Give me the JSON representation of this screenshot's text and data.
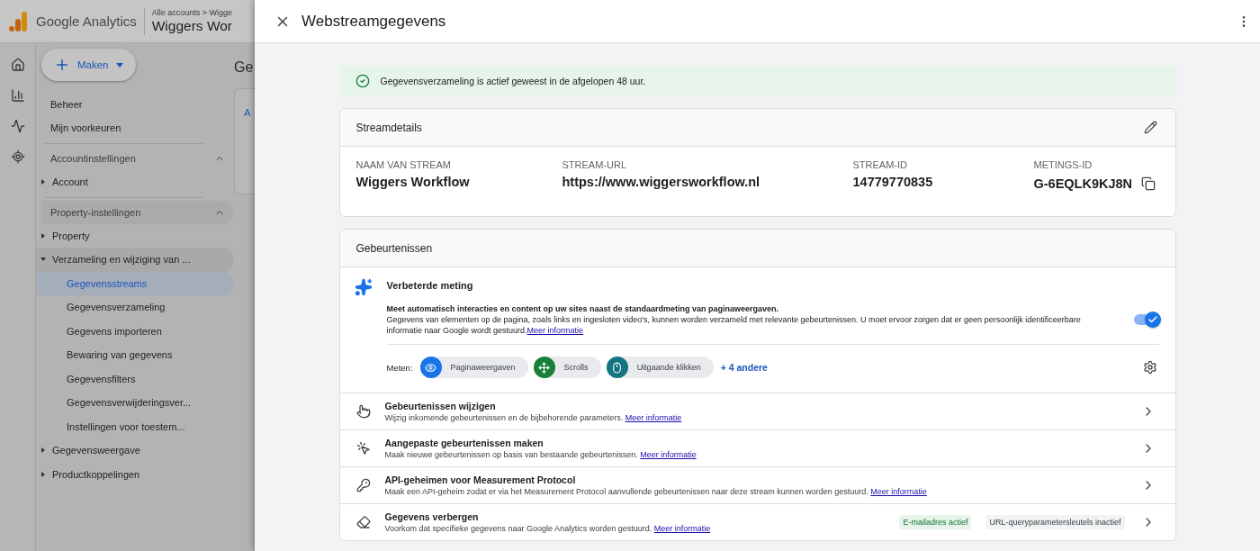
{
  "app": {
    "product": "Google Analytics",
    "breadcrumb": "Alle accounts > Wigge",
    "property": "Wiggers Wor",
    "create_button": "Maken"
  },
  "sidebar": {
    "links": [
      "Beheer",
      "Mijn voorkeuren"
    ],
    "sections": [
      {
        "title": "Accountinstellingen",
        "expanded": true,
        "items": [
          {
            "label": "Account",
            "expanded": false
          }
        ]
      },
      {
        "title": "Property-instellingen",
        "expanded": true,
        "items": [
          {
            "label": "Property",
            "expanded": false
          },
          {
            "label": "Verzameling en wijziging van ...",
            "expanded": true,
            "children": [
              {
                "label": "Gegevensstreams",
                "selected": true
              },
              {
                "label": "Gegevensverzameling",
                "selected": false
              },
              {
                "label": "Gegevens importeren",
                "selected": false
              },
              {
                "label": "Bewaring van gegevens",
                "selected": false
              },
              {
                "label": "Gegevensfilters",
                "selected": false
              },
              {
                "label": "Gegevensverwijderingsver...",
                "selected": false
              },
              {
                "label": "Instellingen voor toestem...",
                "selected": false
              }
            ]
          },
          {
            "label": "Gegevensweergave",
            "expanded": false
          },
          {
            "label": "Productkoppelingen",
            "expanded": false
          }
        ]
      }
    ]
  },
  "background_page": {
    "title": "Ge",
    "tab": "A"
  },
  "panel": {
    "title": "Webstreamgegevens",
    "status": "Gegevensverzameling is actief geweest in de afgelopen 48 uur.",
    "stream_details": {
      "title": "Streamdetails",
      "fields": [
        {
          "label": "NAAM VAN STREAM",
          "value": "Wiggers Workflow",
          "copyable": false
        },
        {
          "label": "STREAM-URL",
          "value": "https://www.wiggersworkflow.nl",
          "copyable": false
        },
        {
          "label": "STREAM-ID",
          "value": "14779770835",
          "copyable": false
        },
        {
          "label": "METINGS-ID",
          "value": "G-6EQLK9KJ8N",
          "copyable": true
        }
      ]
    },
    "events": {
      "title": "Gebeurtenissen",
      "enhanced": {
        "title": "Verbeterde meting",
        "lead": "Meet automatisch interacties en content op uw sites naast de standaardmeting van paginaweergaven.",
        "body": "Gegevens van elementen op de pagina, zoals links en ingesloten video's, kunnen worden verzameld met relevante gebeurtenissen. U moet ervoor zorgen dat er geen persoonlijk identificeerbare informatie naar Google wordt gestuurd.",
        "link": "Meer informatie",
        "on": true,
        "measure_label": "Meten:",
        "chips": [
          {
            "label": "Paginaweergaven",
            "kind": "eye",
            "color": "#1a73e8"
          },
          {
            "label": "Scrolls",
            "kind": "scroll",
            "color": "#188038"
          },
          {
            "label": "Uitgaande klikken",
            "kind": "mouse",
            "color": "#12757f"
          }
        ],
        "more": "+ 4 andere"
      },
      "rows": [
        {
          "kind": "touch",
          "title": "Gebeurtenissen wijzigen",
          "description": "Wijzig inkomende gebeurtenissen en de bijbehorende parameters.",
          "link": "Meer informatie"
        },
        {
          "kind": "click",
          "title": "Aangepaste gebeurtenissen maken",
          "description": "Maak nieuwe gebeurtenissen op basis van bestaande gebeurtenissen.",
          "link": "Meer informatie"
        },
        {
          "kind": "key",
          "title": "API-geheimen voor Measurement Protocol",
          "description": "Maak een API-geheim zodat er via het Measurement Protocol aanvullende gebeurtenissen naar deze stream kunnen worden gestuurd.",
          "link": "Meer informatie"
        },
        {
          "kind": "eraser",
          "title": "Gegevens verbergen",
          "description": "Voorkom dat specifieke gegevens naar Google Analytics worden gestuurd.",
          "link": "Meer informatie",
          "tags": [
            {
              "label": "E-mailadres actief",
              "on": true
            },
            {
              "label": "URL-queryparametersleutels inactief",
              "on": false
            }
          ]
        }
      ]
    }
  }
}
